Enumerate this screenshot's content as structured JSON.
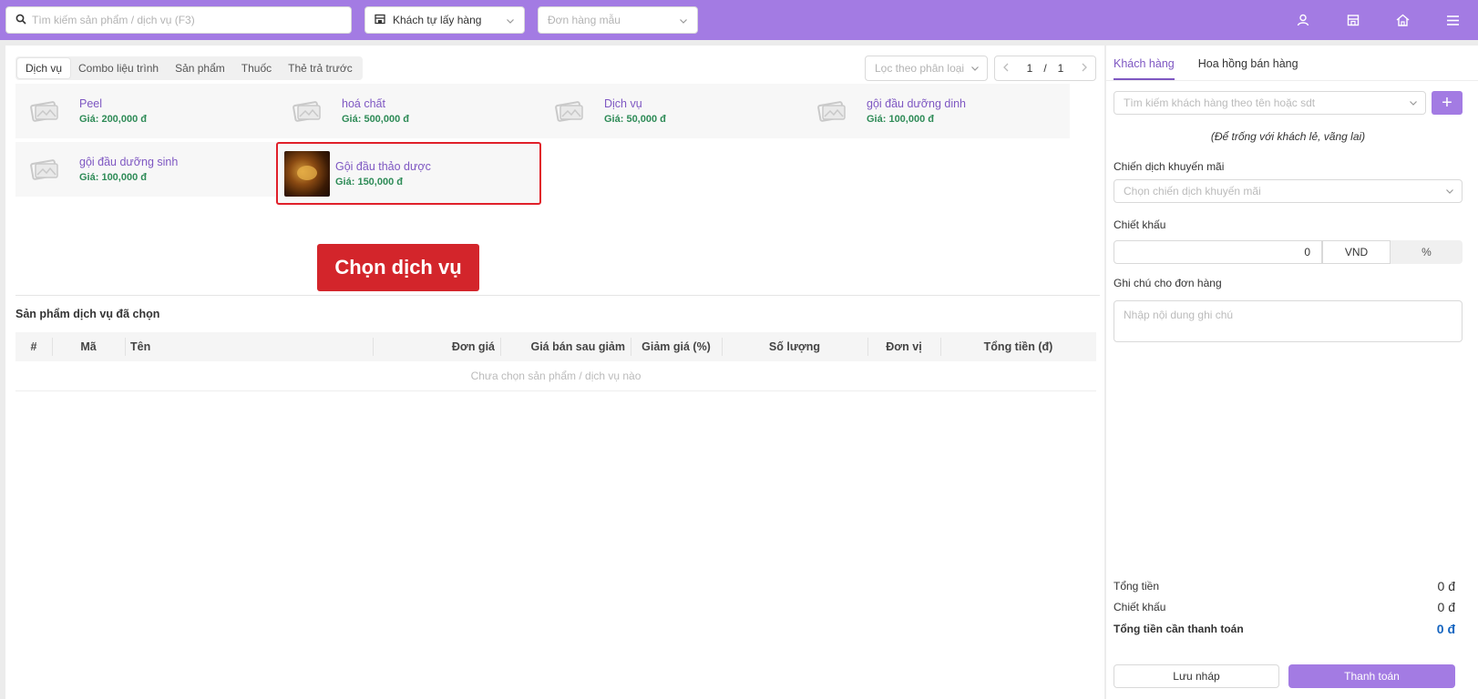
{
  "header": {
    "search_placeholder": "Tìm kiếm sản phẩm / dịch vụ (F3)",
    "shipping_option": "Khách tự lấy hàng",
    "template_placeholder": "Đơn hàng mẫu",
    "icons": [
      "user-icon",
      "store-icon",
      "home-icon",
      "menu-icon"
    ],
    "accent": "#a37be3"
  },
  "category_tabs": [
    {
      "label": "Dịch vụ",
      "active": true
    },
    {
      "label": "Combo liệu trình",
      "active": false
    },
    {
      "label": "Sản phẩm",
      "active": false
    },
    {
      "label": "Thuốc",
      "active": false
    },
    {
      "label": "Thẻ trả trước",
      "active": false
    }
  ],
  "filter_placeholder": "Lọc theo phân loại",
  "pagination": {
    "current": "1",
    "separator": "/",
    "total": "1"
  },
  "services": [
    {
      "name": "Peel",
      "price": "Giá: 200,000 đ"
    },
    {
      "name": "hoá chất",
      "price": "Giá: 500,000 đ"
    },
    {
      "name": "Dịch vụ",
      "price": "Giá: 50,000 đ"
    },
    {
      "name": "gội đầu dưỡng dinh",
      "price": "Giá: 100,000 đ"
    },
    {
      "name": "gội đầu dưỡng sinh",
      "price": "Giá: 100,000 đ"
    },
    {
      "name": "Gội đầu thảo dược",
      "price": "Giá: 150,000 đ"
    }
  ],
  "annotation": {
    "callout": "Chọn dịch vụ",
    "color": "#d3252b"
  },
  "selected_section": {
    "title": "Sản phẩm dịch vụ đã chọn",
    "columns": [
      "#",
      "Mã",
      "Tên",
      "Đơn giá",
      "Giá bán sau giảm",
      "Giảm giá (%)",
      "Số lượng",
      "Đơn vị",
      "Tổng tiền (đ)"
    ],
    "empty_text": "Chưa chọn sản phẩm / dịch vụ nào"
  },
  "right": {
    "tabs": [
      {
        "label": "Khách hàng",
        "active": true
      },
      {
        "label": "Hoa hồng bán hàng",
        "active": false
      }
    ],
    "customer_search_placeholder": "Tìm kiếm khách hàng theo tên hoặc sdt",
    "add_label": "+",
    "walk_in_note": "(Để trống với khách lẻ, vãng lai)",
    "promo_label": "Chiến dịch khuyến mãi",
    "promo_placeholder": "Chọn chiến dịch khuyến mãi",
    "discount_label": "Chiết khấu",
    "discount_value": "0",
    "discount_unit_vnd": "VND",
    "discount_unit_pct": "%",
    "note_label": "Ghi chú cho đơn hàng",
    "note_placeholder": "Nhập nội dung ghi chú",
    "summary": {
      "subtotal_label": "Tổng tiền",
      "subtotal_value": "0 đ",
      "discount_label": "Chiết khấu",
      "discount_value": "0 đ",
      "total_label": "Tổng tiền cần thanh toán",
      "total_value": "0 đ"
    },
    "draft_button": "Lưu nháp",
    "pay_button": "Thanh toán"
  }
}
